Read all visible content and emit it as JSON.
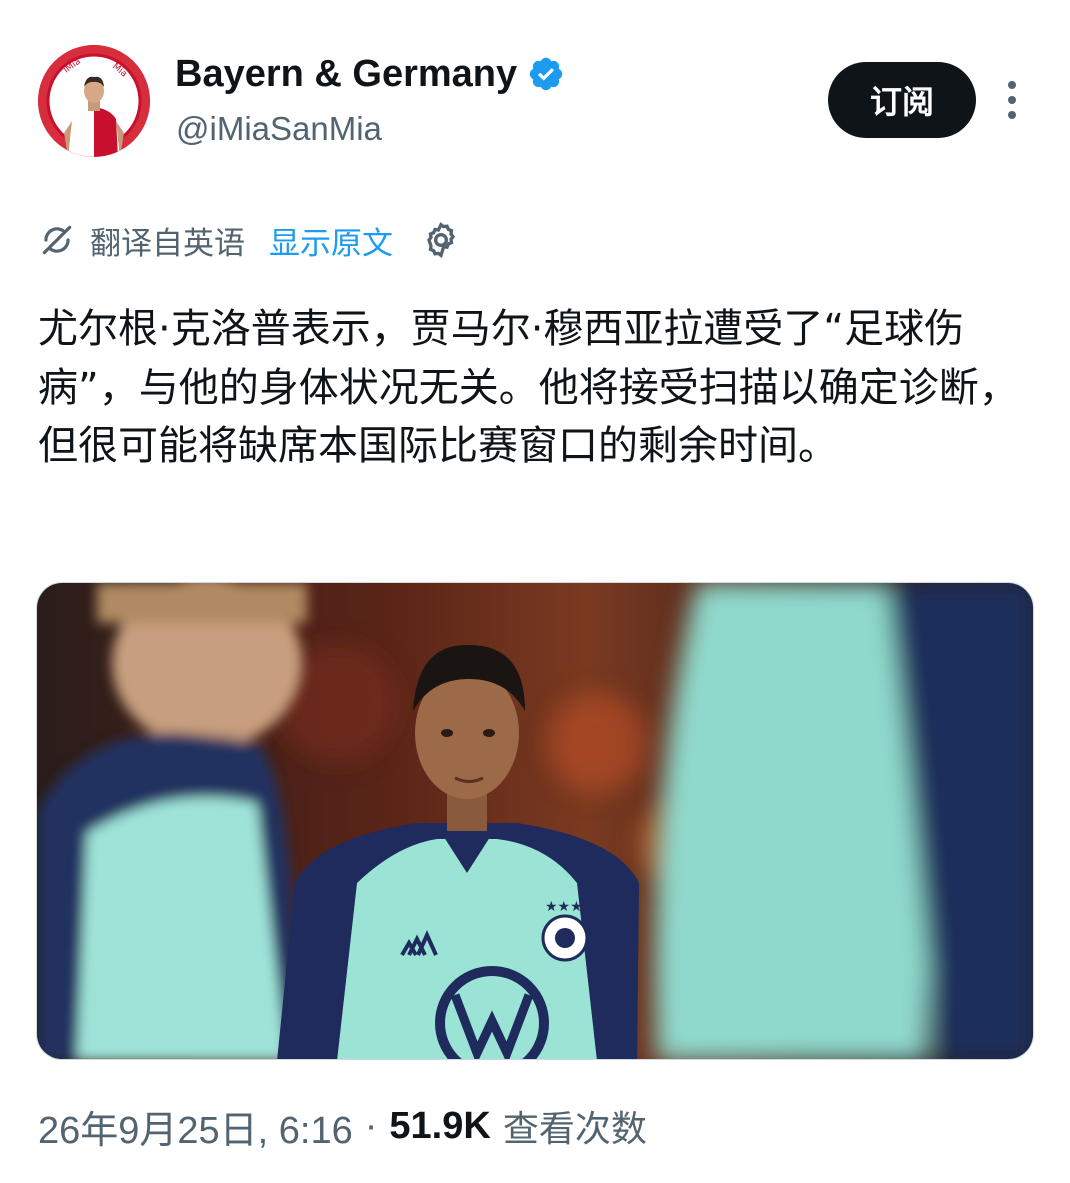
{
  "author": {
    "display_name": "Bayern & Germany",
    "handle": "@iMiaSanMia",
    "avatar_icon": "profile-avatar",
    "avatar_text": "iMiaSanMia",
    "verified_icon": "verified-badge-icon",
    "verified_color": "#1d9bf0"
  },
  "actions": {
    "subscribe_label": "订阅",
    "more_icon": "more-options-icon"
  },
  "translation": {
    "label": "翻译自英语",
    "show_original": "显示原文",
    "translate_icon": "translate-icon",
    "settings_icon": "gear-icon"
  },
  "tweet": {
    "text": "尤尔根·克洛普表示，贾马尔·穆西亚拉遭受了“足球伤病”，与他的身体状况无关。他将接受扫描以确定诊断，但很可能将缺席本国际比赛窗口的剩余时间。",
    "media_icon": "tweet-photo"
  },
  "meta": {
    "timestamp": "26年9月25日, 6:16",
    "separator": "·",
    "views_count": "51.9K",
    "views_label": "查看次数"
  },
  "colors": {
    "text_primary": "#0f1419",
    "text_secondary": "#536471",
    "accent": "#1d9bf0",
    "button_bg": "#0f1419"
  }
}
